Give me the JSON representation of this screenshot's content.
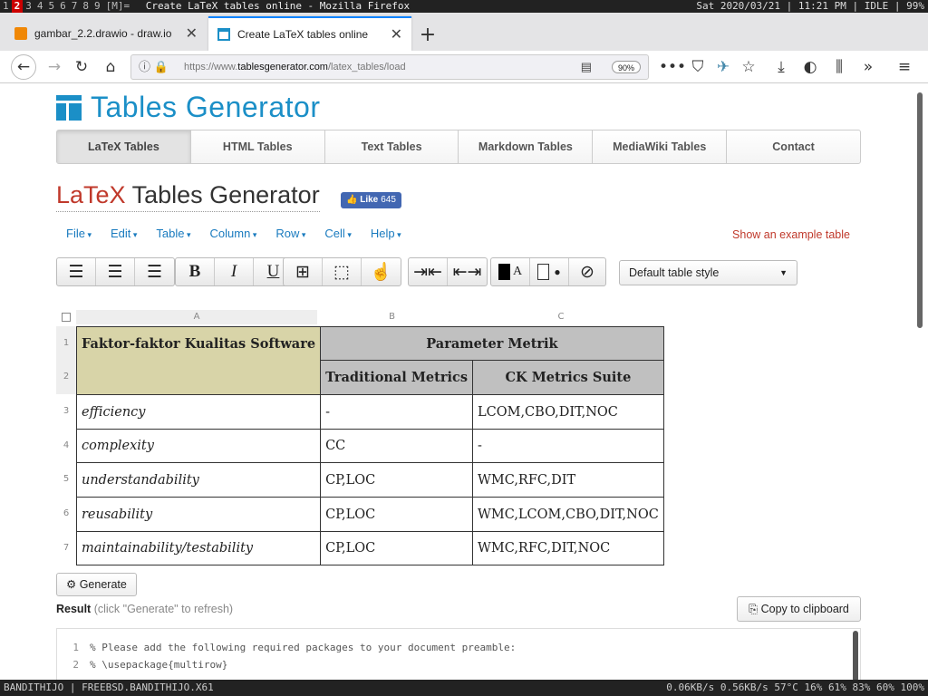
{
  "wm": {
    "workspaces": [
      "1",
      "2",
      "3",
      "4",
      "5",
      "6",
      "7",
      "8",
      "9",
      "[M]="
    ],
    "active_workspace": "2",
    "window_title": "Create LaTeX tables online - Mozilla Firefox",
    "status_right": "Sat 2020/03/21 | 11:21 PM | IDLE | 99%"
  },
  "browser": {
    "tabs": [
      {
        "title": "gambar_2.2.drawio - draw.io",
        "active": false
      },
      {
        "title": "Create LaTeX tables online",
        "active": true
      }
    ],
    "url_prefix": "https://www.",
    "url_domain": "tablesgenerator.com",
    "url_path": "/latex_tables/load",
    "zoom": "90%"
  },
  "site": {
    "logo_text": "Tables Generator",
    "nav": [
      "LaTeX Tables",
      "HTML Tables",
      "Text Tables",
      "Markdown Tables",
      "MediaWiki Tables",
      "Contact"
    ],
    "active_nav": "LaTeX Tables",
    "heading_red": "LaTeX",
    "heading_rest": " Tables Generator",
    "like_label": "Like",
    "like_count": "645",
    "menus": [
      "File",
      "Edit",
      "Table",
      "Column",
      "Row",
      "Cell",
      "Help"
    ],
    "example_link": "Show an example table",
    "table_style": "Default table style"
  },
  "editor": {
    "col_headers": [
      "A",
      "B",
      "C"
    ],
    "row_numbers": [
      "1",
      "2",
      "3",
      "4",
      "5",
      "6",
      "7"
    ],
    "header_merged": "Faktor-faktor Kualitas Software",
    "header_group": "Parameter Metrik",
    "sub_headers": [
      "Traditional Metrics",
      "CK Metrics Suite"
    ],
    "rows": [
      [
        "efficiency",
        "-",
        "LCOM,CBO,DIT,NOC"
      ],
      [
        "complexity",
        "CC",
        "-"
      ],
      [
        "understandability",
        "CP,LOC",
        "WMC,RFC,DIT"
      ],
      [
        "reusability",
        "CP,LOC",
        "WMC,LCOM,CBO,DIT,NOC"
      ],
      [
        "maintainability/testability",
        "CP,LOC",
        "WMC,RFC,DIT,NOC"
      ]
    ]
  },
  "output": {
    "generate_label": "Generate",
    "result_label": "Result",
    "result_hint": "(click \"Generate\" to refresh)",
    "copy_label": "Copy to clipboard",
    "code_lines": [
      {
        "n": "1",
        "text": "% Please add the following required packages to your document preamble:"
      },
      {
        "n": "2",
        "text": "% \\usepackage{multirow}"
      }
    ]
  },
  "bottombar": {
    "left": "BANDITHIJO | FREEBSD.BANDITHIJO.X61",
    "right": "0.06KB/s  0.56KB/s  57°C  16%  61%  83%  60%  100%"
  }
}
